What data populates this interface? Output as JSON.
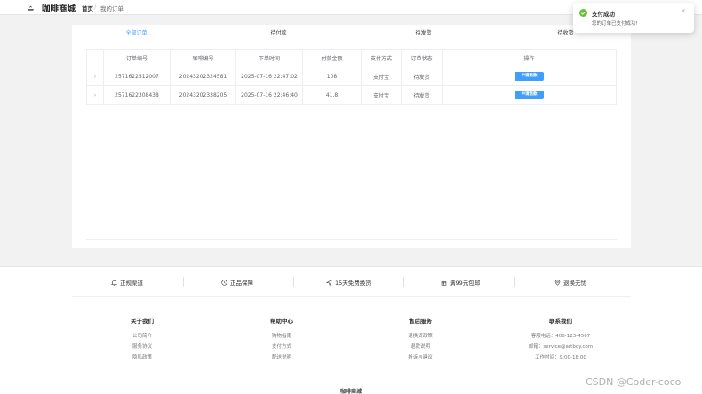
{
  "header": {
    "brand": "咖啡商城",
    "breadcrumb_home": "首页",
    "breadcrumb_sep": "/",
    "breadcrumb_current": "我的订单"
  },
  "tabs": [
    {
      "label": "全部订单",
      "active": true
    },
    {
      "label": "待付款",
      "active": false
    },
    {
      "label": "待发货",
      "active": false
    },
    {
      "label": "待收货",
      "active": false
    }
  ],
  "table": {
    "columns": [
      "订单编号",
      "咖啡编号",
      "下单时间",
      "付款金额",
      "支付方式",
      "订单状态",
      "操作"
    ],
    "rows": [
      {
        "order_no": "2571622512007",
        "coffee_no": "20243202324581",
        "time": "2025-07-16 22:47:02",
        "amount": "108",
        "pay_method": "支付宝",
        "status": "待发货",
        "action": "申请退款"
      },
      {
        "order_no": "2571622308438",
        "coffee_no": "20243202338205",
        "time": "2025-07-16 22:46:40",
        "amount": "41.8",
        "pay_method": "支付宝",
        "status": "待发货",
        "action": "申请退款"
      }
    ]
  },
  "features": [
    {
      "label": "正规渠道",
      "icon": "bell-icon"
    },
    {
      "label": "正品保障",
      "icon": "clock-icon"
    },
    {
      "label": "15天免费换货",
      "icon": "send-icon"
    },
    {
      "label": "满99元包邮",
      "icon": "gift-icon"
    },
    {
      "label": "退换无忧",
      "icon": "location-icon"
    }
  ],
  "footer_columns": [
    {
      "title": "关于我们",
      "links": [
        "公司简介",
        "服务协议",
        "隐私政策"
      ]
    },
    {
      "title": "帮助中心",
      "links": [
        "购物指南",
        "支付方式",
        "配送说明"
      ]
    },
    {
      "title": "售后服务",
      "links": [
        "退换货政策",
        "退款说明",
        "投诉与建议"
      ]
    },
    {
      "title": "联系我们",
      "links": [
        "客服电话：400-123-4567",
        "邮箱：service@artboy.com",
        "工作时间：9:00-18:00"
      ]
    }
  ],
  "footer_bottom": "咖啡商城",
  "watermark": "CSDN @Coder-coco",
  "toast": {
    "title": "支付成功",
    "message": "您的订单已支付成功!",
    "color": "#67c23a"
  },
  "colors": {
    "primary": "#409eff",
    "success": "#67c23a"
  }
}
